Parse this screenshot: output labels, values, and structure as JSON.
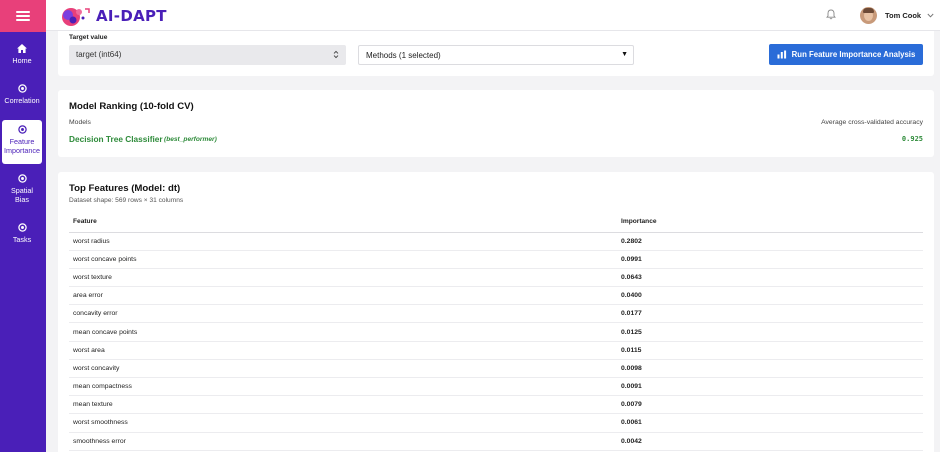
{
  "sidebar": {
    "items": [
      {
        "label": "Home",
        "icon": "home-icon"
      },
      {
        "label": "Correlation",
        "icon": "target-icon"
      },
      {
        "label": "Feature Importance",
        "line1": "Feature",
        "line2": "Importance",
        "icon": "target-icon",
        "active": true
      },
      {
        "label": "Spatial Bias",
        "line1": "Spatial",
        "line2": "Bias",
        "icon": "target-icon"
      },
      {
        "label": "Tasks",
        "icon": "target-icon"
      }
    ]
  },
  "header": {
    "logo_text": "AI-DAPT",
    "user_name": "Tom Cook"
  },
  "controls": {
    "target_label": "Target value",
    "target_value": "target (int64)",
    "methods_value": "Methods (1 selected)",
    "run_button": "Run Feature Importance Analysis"
  },
  "ranking": {
    "title": "Model Ranking (10-fold CV)",
    "models_label": "Models",
    "accuracy_label": "Average cross-validated accuracy",
    "model_name": "Decision Tree Classifier",
    "model_tag": "(best_performer)",
    "model_score": "0.925"
  },
  "features": {
    "title": "Top Features (Model: dt)",
    "dataset_shape": "Dataset shape: 569 rows × 31 columns",
    "columns": [
      "Feature",
      "Importance"
    ],
    "rows": [
      [
        "worst radius",
        "0.2802"
      ],
      [
        "worst concave points",
        "0.0991"
      ],
      [
        "worst texture",
        "0.0643"
      ],
      [
        "area error",
        "0.0400"
      ],
      [
        "concavity error",
        "0.0177"
      ],
      [
        "mean concave points",
        "0.0125"
      ],
      [
        "worst area",
        "0.0115"
      ],
      [
        "worst concavity",
        "0.0098"
      ],
      [
        "mean compactness",
        "0.0091"
      ],
      [
        "mean texture",
        "0.0079"
      ],
      [
        "worst smoothness",
        "0.0061"
      ],
      [
        "smoothness error",
        "0.0042"
      ]
    ]
  },
  "colors": {
    "sidebar": "#4a1fb8",
    "menu_button": "#e8407a",
    "primary_button": "#2a6cd8",
    "success_text": "#2e8b3a"
  }
}
